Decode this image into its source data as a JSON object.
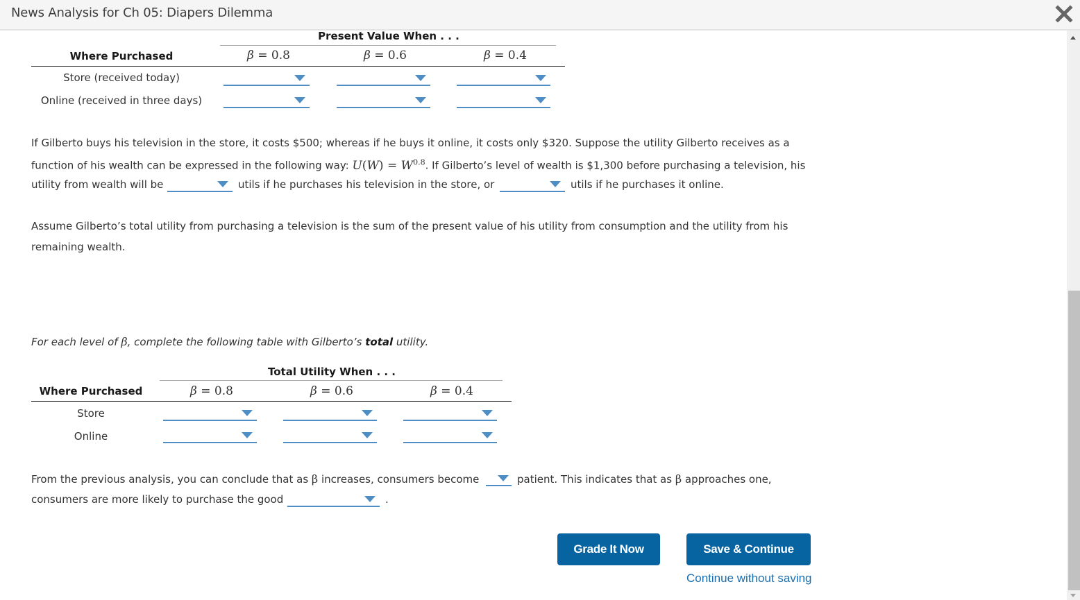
{
  "window": {
    "title": "News Analysis for Ch 05: Diapers Dilemma",
    "close_icon": "close-x-icon"
  },
  "pv_table": {
    "group_header": "Present Value When . . .",
    "row_header": "Where Purchased",
    "beta_symbol": "β",
    "columns": [
      "= 0.8",
      "= 0.6",
      "= 0.4"
    ],
    "rows": [
      {
        "label": "Store (received today)",
        "values": [
          "",
          "",
          ""
        ]
      },
      {
        "label": "Online (received in three days)",
        "values": [
          "",
          "",
          ""
        ]
      }
    ]
  },
  "paragraph1": {
    "line1": "If Gilberto buys his television in the store, it costs $500; whereas if he buys it online, it costs only $320. Suppose the utility Gilberto receives as a",
    "line2_pre": "function of his wealth can be expressed in the following way:",
    "formula_U": "U",
    "formula_W": "W",
    "formula_eq": ") =",
    "formula_base": "W",
    "formula_exp": "0.8",
    "line2_post": ". If Gilberto’s level of wealth is $1,300 before purchasing a television, his",
    "line3_pre": "utility from wealth will be",
    "line3_mid": "utils if he purchases his television in the store, or",
    "line3_post": "utils if he purchases it online.",
    "store_utility_value": "",
    "online_utility_value": ""
  },
  "paragraph2": {
    "line1": "Assume Gilberto’s total utility from purchasing a television is the sum of the present value of his utility from consumption and the utility from his",
    "line2": "remaining wealth."
  },
  "instruction": {
    "pre": "For each level of",
    "beta": "β",
    "mid": ", complete the following table with Gilberto’s",
    "bold": "total",
    "post": "utility."
  },
  "tu_table": {
    "group_header": "Total Utility When . . .",
    "row_header": "Where Purchased",
    "beta_symbol": "β",
    "columns": [
      "= 0.8",
      "= 0.6",
      "= 0.4"
    ],
    "rows": [
      {
        "label": "Store",
        "values": [
          "",
          "",
          ""
        ]
      },
      {
        "label": "Online",
        "values": [
          "",
          "",
          ""
        ]
      }
    ]
  },
  "conclusion": {
    "line1_pre": "From the previous analysis, you can conclude that as",
    "beta": "β",
    "line1_mid": "increases, consumers become",
    "line1_post_a": "patient. This indicates that as",
    "line1_post_b": "approaches one,",
    "line2_pre": "consumers are more likely to purchase the good",
    "line2_post": ".",
    "patience_value": "",
    "purchase_value": ""
  },
  "actions": {
    "grade_label": "Grade It Now",
    "save_label": "Save & Continue",
    "continue_link": "Continue without saving"
  },
  "colors": {
    "primary_button": "#0864a0",
    "dropdown_accent": "#4f8dc5",
    "link": "#1a6fb0"
  }
}
